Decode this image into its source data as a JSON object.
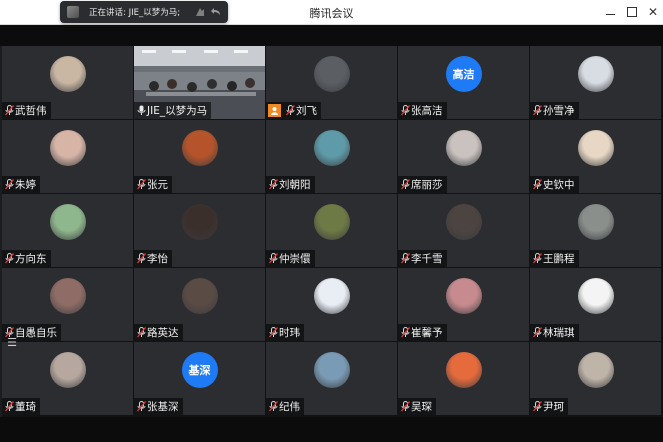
{
  "window": {
    "title": "腾讯会议",
    "controls": {
      "minimize": "minimize",
      "maximize": "maximize",
      "close": "✕"
    }
  },
  "speaking": {
    "label": "正在讲话: JIE_以梦为马;",
    "icons": [
      "hand-icon",
      "rewind-icon"
    ]
  },
  "participants": [
    {
      "name": "武哲伟",
      "avatar_color": "#c9b7a3",
      "muted": true
    },
    {
      "name": "JIE_以梦为马",
      "video": true,
      "muted": false
    },
    {
      "name": "刘飞",
      "avatar_color": "#5b5f63",
      "muted": true,
      "host_badge": true
    },
    {
      "name": "张高洁",
      "avatar_text": "高洁",
      "avatar_color": "#1e7bf5",
      "muted": true
    },
    {
      "name": "孙雪净",
      "avatar_color": "#d7dde3",
      "muted": true
    },
    {
      "name": "朱婷",
      "avatar_color": "#d6b4a6",
      "muted": true
    },
    {
      "name": "张元",
      "avatar_color": "#b5542b",
      "muted": true
    },
    {
      "name": "刘朝阳",
      "avatar_color": "#5e9aa8",
      "muted": true
    },
    {
      "name": "席丽莎",
      "avatar_color": "#c9c2bf",
      "muted": true
    },
    {
      "name": "史钦中",
      "avatar_color": "#e7d7c4",
      "muted": true
    },
    {
      "name": "方向东",
      "avatar_color": "#8fb78d",
      "muted": true
    },
    {
      "name": "李怡",
      "avatar_color": "#3b2f2c",
      "muted": true
    },
    {
      "name": "仲崇儇",
      "avatar_color": "#6e7a45",
      "muted": true
    },
    {
      "name": "李千雪",
      "avatar_color": "#4c4441",
      "muted": true
    },
    {
      "name": "王鹏程",
      "avatar_color": "#8a8f8c",
      "muted": true
    },
    {
      "name": "自愚自乐",
      "avatar_color": "#8f6d66",
      "muted": true
    },
    {
      "name": "路英达",
      "avatar_color": "#5a4b45",
      "muted": true
    },
    {
      "name": "时玮",
      "avatar_color": "#e9eef5",
      "muted": true
    },
    {
      "name": "崔馨予",
      "avatar_color": "#c78b8f",
      "muted": true
    },
    {
      "name": "林瑞琪",
      "avatar_color": "#f4f4f4",
      "muted": true
    },
    {
      "name": "董琦",
      "avatar_color": "#b7a89f",
      "muted": true
    },
    {
      "name": "张基深",
      "avatar_text": "基深",
      "avatar_color": "#1e7bf5",
      "muted": true
    },
    {
      "name": "纪伟",
      "avatar_color": "#7a9bb5",
      "muted": true
    },
    {
      "name": "吴琛",
      "avatar_color": "#e56b3d",
      "muted": true
    },
    {
      "name": "尹珂",
      "avatar_color": "#bfb4a8",
      "muted": true
    }
  ]
}
